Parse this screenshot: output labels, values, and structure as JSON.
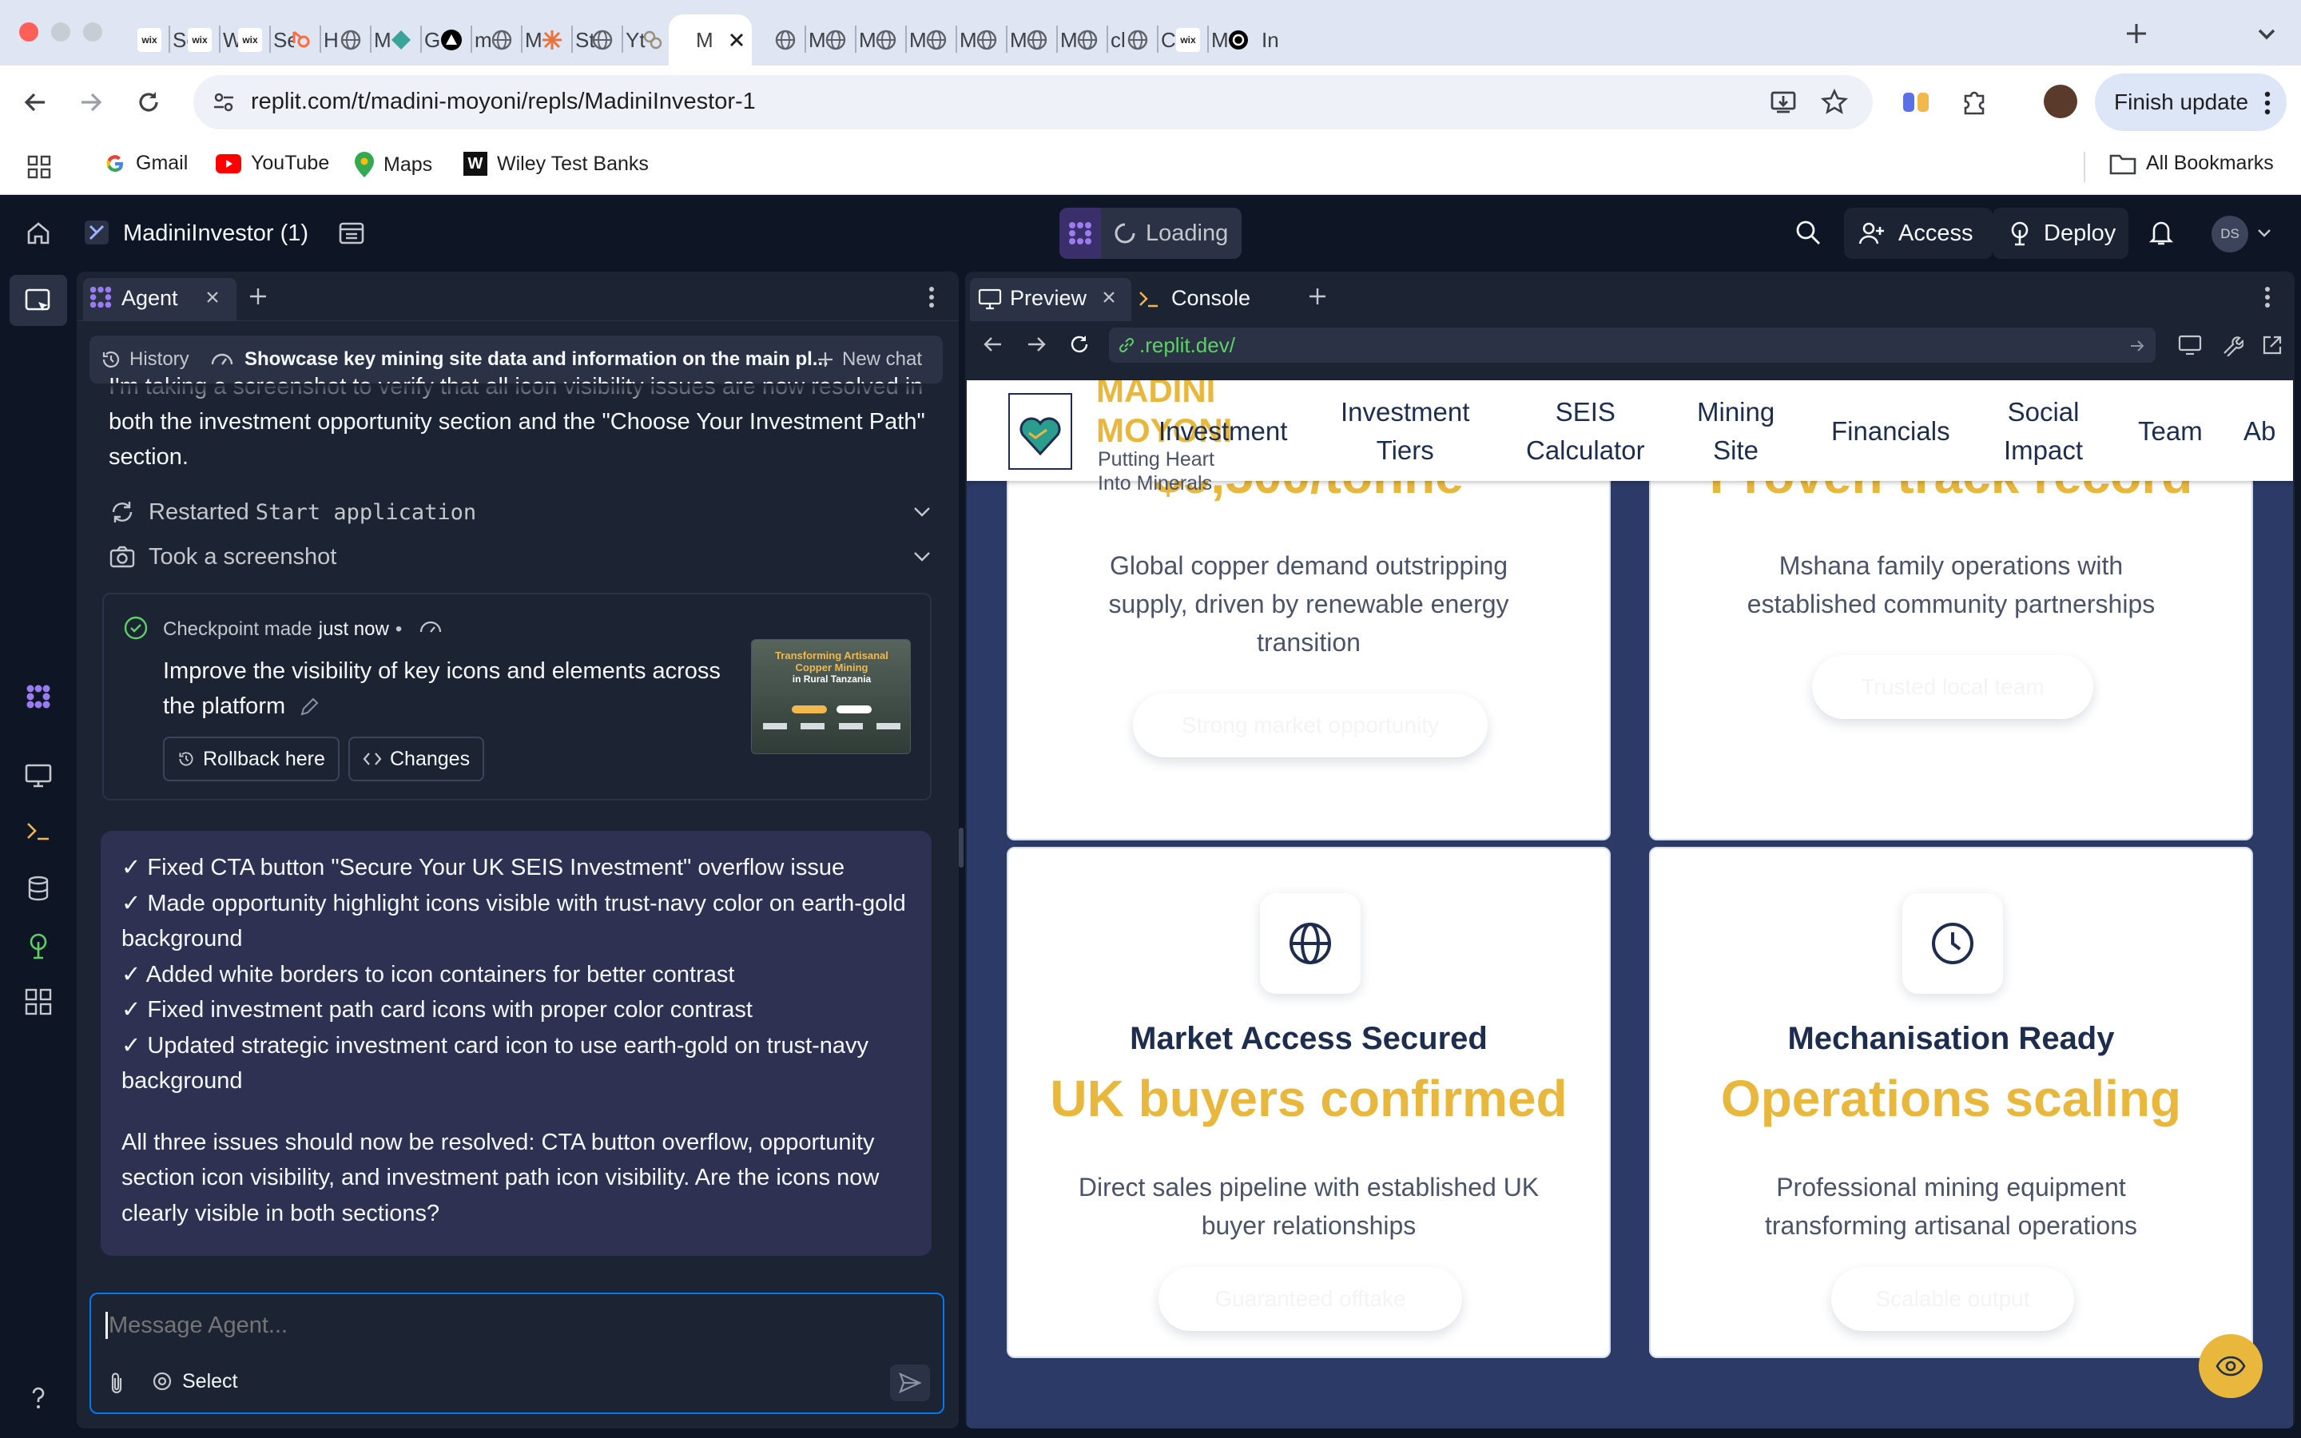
{
  "browser": {
    "tabs": [
      {
        "title": "Se",
        "fav": "wix",
        "color": "#ffffff"
      },
      {
        "title": "W",
        "fav": "wix",
        "color": "#ffffff"
      },
      {
        "title": "Se",
        "fav": "wix",
        "color": "#ffffff"
      },
      {
        "title": "H",
        "fav": "hub",
        "color": "#ff6b3d"
      },
      {
        "title": "M",
        "fav": "globe",
        "color": "#5f6368"
      },
      {
        "title": "G",
        "fav": "diamond",
        "color": "#3aa39a"
      },
      {
        "title": "m",
        "fav": "triangle",
        "color": "#000000"
      },
      {
        "title": "M",
        "fav": "globe",
        "color": "#5f6368"
      },
      {
        "title": "St",
        "fav": "sun",
        "color": "#e8743c"
      },
      {
        "title": "Yt",
        "fav": "globe",
        "color": "#5f6368"
      },
      {
        "title": "H",
        "fav": "knot",
        "color": "#9a8f7a"
      },
      {
        "title": "M",
        "fav": "",
        "color": "#ffffff"
      },
      {
        "title": "M",
        "fav": "globe",
        "color": "#5f6368"
      },
      {
        "title": "M",
        "fav": "globe",
        "color": "#5f6368"
      },
      {
        "title": "M",
        "fav": "globe",
        "color": "#5f6368"
      },
      {
        "title": "M",
        "fav": "globe",
        "color": "#5f6368"
      },
      {
        "title": "M",
        "fav": "globe",
        "color": "#5f6368"
      },
      {
        "title": "M",
        "fav": "globe",
        "color": "#5f6368"
      },
      {
        "title": "cl",
        "fav": "globe",
        "color": "#5f6368"
      },
      {
        "title": "C",
        "fav": "globe",
        "color": "#5f6368"
      },
      {
        "title": "M",
        "fav": "wix",
        "color": "#ffffff"
      },
      {
        "title": "In",
        "fav": "openai",
        "color": "#000000"
      }
    ],
    "url": "replit.com/t/madini-moyoni/repls/MadiniInvestor-1",
    "finish_update": "Finish update",
    "bookmarks": {
      "gmail": "Gmail",
      "youtube": "YouTube",
      "maps": "Maps",
      "wiley": "Wiley Test Banks",
      "all": "All Bookmarks"
    }
  },
  "replit": {
    "repl_name": "MadiniInvestor (1)",
    "loading": "Loading",
    "access": "Access",
    "deploy": "Deploy",
    "avatar": "DS",
    "agent": {
      "tab": "Agent",
      "history": "History",
      "thread_title": "Showcase key mining site data and information on the main pl...",
      "new_chat": "New chat",
      "partial_message": "I'm taking a screenshot to verify that all icon visibility issues are now resolved in both the investment opportunity section and the \"Choose Your Investment Path\" section.",
      "action1_prefix": "Restarted ",
      "action1_code": "Start application",
      "action2": "Took a screenshot",
      "checkpoint": {
        "label": "Checkpoint made",
        "time": "just now",
        "dot": "•",
        "title": "Improve the visibility of key icons and elements across the platform",
        "rollback": "Rollback here",
        "changes": "Changes",
        "thumb_title1": "Transforming Artisanal",
        "thumb_title2": "Copper Mining",
        "thumb_title3": "in Rural Tanzania"
      },
      "summary_lines": [
        "✓ Fixed CTA button \"Secure Your UK SEIS Investment\" overflow issue",
        "✓ Made opportunity highlight icons visible with trust-navy color on earth-gold",
        "background",
        "✓ Added white borders to icon containers for better contrast",
        "✓ Fixed investment path card icons with proper color contrast",
        "✓ Updated strategic investment card icon to use earth-gold on trust-navy",
        "background"
      ],
      "summary_para": [
        "All three issues should now be resolved: CTA button overflow, opportunity",
        "section icon visibility, and investment path icon visibility. Are the icons now",
        "clearly visible in both sections?"
      ],
      "composer_placeholder": "Message Agent...",
      "select": "Select"
    },
    "preview": {
      "tab_preview": "Preview",
      "tab_console": "Console",
      "url": ".replit.dev/",
      "site": {
        "brand_line1": "MADINI",
        "brand_line2": "MOYONI",
        "tagline1": "Putting Heart",
        "tagline2": "Into Minerals",
        "nav": {
          "investment": "Investment",
          "tiers1": "Investment",
          "tiers2": "Tiers",
          "seis1": "SEIS",
          "seis2": "Calculator",
          "mining1": "Mining",
          "mining2": "Site",
          "financials": "Financials",
          "social1": "Social",
          "social2": "Impact",
          "team": "Team",
          "about": "Ab"
        },
        "cards": [
          {
            "big": "$9,500/tonne",
            "desc1": "Global copper demand outstripping",
            "desc2": "supply, driven by renewable energy",
            "desc3": "transition",
            "btn": "Strong market opportunity"
          },
          {
            "big": "Proven track record",
            "desc1": "Mshana family operations with",
            "desc2": "established community partnerships",
            "btn": "Trusted local team"
          },
          {
            "label": "Market Access Secured",
            "big": "UK buyers confirmed",
            "desc1": "Direct sales pipeline with established UK",
            "desc2": "buyer relationships",
            "btn": "Guaranteed offtake",
            "icon": "globe-icon"
          },
          {
            "label": "Mechanisation Ready",
            "big": "Operations scaling",
            "desc1": "Professional mining equipment",
            "desc2": "transforming artisanal operations",
            "btn": "Scalable output",
            "icon": "clock-icon"
          }
        ]
      }
    }
  },
  "colors": {
    "replit_bg": "#0e1525",
    "panel": "#1c2333",
    "summary_bg": "#2e3152",
    "accent_blue": "#0079f2",
    "earth_gold": "#e8b73c",
    "trust_navy": "#1e2d4f",
    "site_bg": "#2b3a66"
  }
}
